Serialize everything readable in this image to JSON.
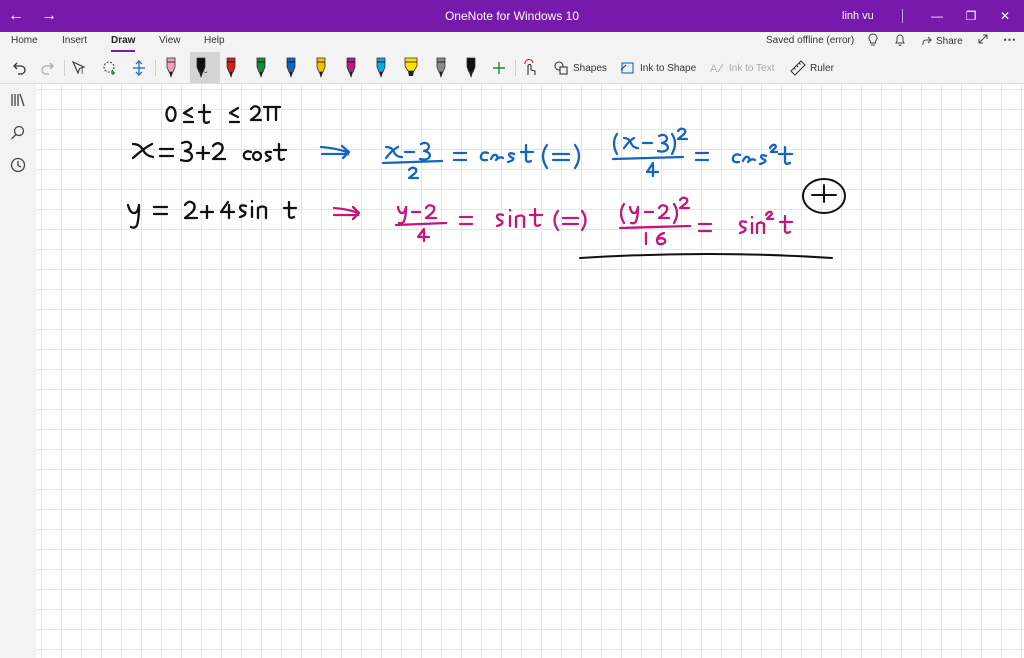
{
  "window": {
    "title": "OneNote for Windows 10",
    "user": "linh vu",
    "accent": "#7719aa"
  },
  "ribbon": {
    "tabs": [
      {
        "label": "Home"
      },
      {
        "label": "Insert"
      },
      {
        "label": "Draw",
        "active": true
      },
      {
        "label": "View"
      },
      {
        "label": "Help"
      }
    ],
    "status": "Saved offline (error)",
    "share_label": "Share"
  },
  "toolbar": {
    "shapes_label": "Shapes",
    "ink_to_shape_label": "Ink to Shape",
    "ink_to_text_label": "Ink to Text",
    "ruler_label": "Ruler",
    "pens": [
      {
        "color": "#f2a0c4",
        "kind": "pen"
      },
      {
        "color": "#111111",
        "kind": "pen",
        "selected": true
      },
      {
        "color": "#d81e1e",
        "kind": "pen"
      },
      {
        "color": "#1b8a3a",
        "kind": "pen"
      },
      {
        "color": "#1565c0",
        "kind": "pen"
      },
      {
        "color": "#f2c200",
        "kind": "pen"
      },
      {
        "color": "#b0207a",
        "kind": "pen"
      },
      {
        "color": "#12a7d8",
        "kind": "pen"
      },
      {
        "color": "#ffe100",
        "kind": "highlighter"
      },
      {
        "color": "#8a8a8a",
        "kind": "pen"
      },
      {
        "color": "#111111",
        "kind": "pen"
      }
    ]
  },
  "rail": {
    "icons": [
      "notebooks-icon",
      "search-icon",
      "recent-icon"
    ]
  },
  "ink_colors": {
    "black": "#111111",
    "blue": "#1565c0",
    "magenta": "#c2187a"
  }
}
